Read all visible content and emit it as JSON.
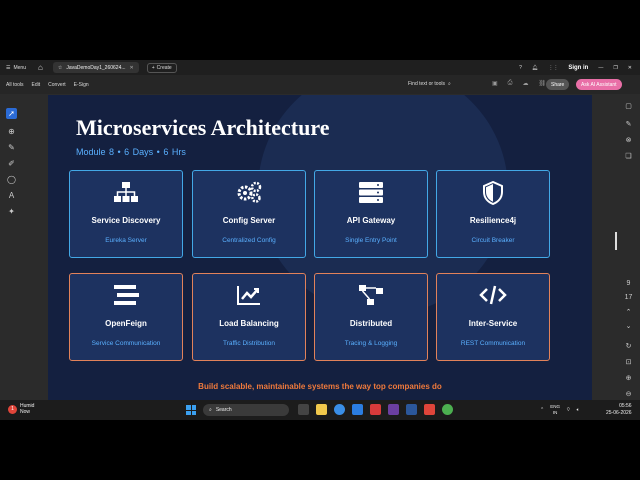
{
  "titlebar": {
    "menu_label": "Menu",
    "tab_title": "JavaDemoDay1_260624...",
    "create_label": "Create",
    "sign_in": "Sign in"
  },
  "toolbar": {
    "items": [
      "All tools",
      "Edit",
      "Convert",
      "E-Sign"
    ],
    "find_label": "Find text or tools",
    "share_label": "Share",
    "ai_label": "Ask AI Assistant"
  },
  "slide": {
    "title": "Microservices Architecture",
    "subtitle": "Module 8  •  6 Days  •  6 Hrs",
    "cards": [
      {
        "icon": "sitemap-icon",
        "name": "Service Discovery",
        "desc": "Eureka Server",
        "accent": "#43a8e6"
      },
      {
        "icon": "gears-icon",
        "name": "Config Server",
        "desc": "Centralized Config",
        "accent": "#43a8e6"
      },
      {
        "icon": "server-icon",
        "name": "API Gateway",
        "desc": "Single Entry Point",
        "accent": "#43a8e6"
      },
      {
        "icon": "shield-icon",
        "name": "Resilience4j",
        "desc": "Circuit Breaker",
        "accent": "#43a8e6"
      },
      {
        "icon": "stream-icon",
        "name": "OpenFeign",
        "desc": "Service Communication",
        "accent": "#e2825a"
      },
      {
        "icon": "chart-line-icon",
        "name": "Load Balancing",
        "desc": "Traffic Distribution",
        "accent": "#e2825a"
      },
      {
        "icon": "project-diagram-icon",
        "name": "Distributed",
        "desc": "Tracing & Logging",
        "accent": "#e2825a"
      },
      {
        "icon": "code-icon",
        "name": "Inter-Service",
        "desc": "REST Communication",
        "accent": "#e2825a"
      }
    ],
    "tagline": "Build scalable, maintainable systems the way top companies do"
  },
  "rail": {
    "page_number": "9",
    "page_total": "17"
  },
  "taskbar": {
    "weather_title": "Humid",
    "weather_sub": "Now",
    "weather_badge": "1",
    "search_label": "Search",
    "lang_top": "ENG",
    "lang_bottom": "IN",
    "time": "05:56",
    "date": "25-06-2026"
  },
  "colors": {
    "slide_bg": "#142040",
    "card_bg": "#1d3260",
    "blue_accent": "#43a8e6",
    "orange_accent": "#e2825a",
    "subtitle": "#5ab0ff",
    "tagline": "#f07a3c"
  }
}
